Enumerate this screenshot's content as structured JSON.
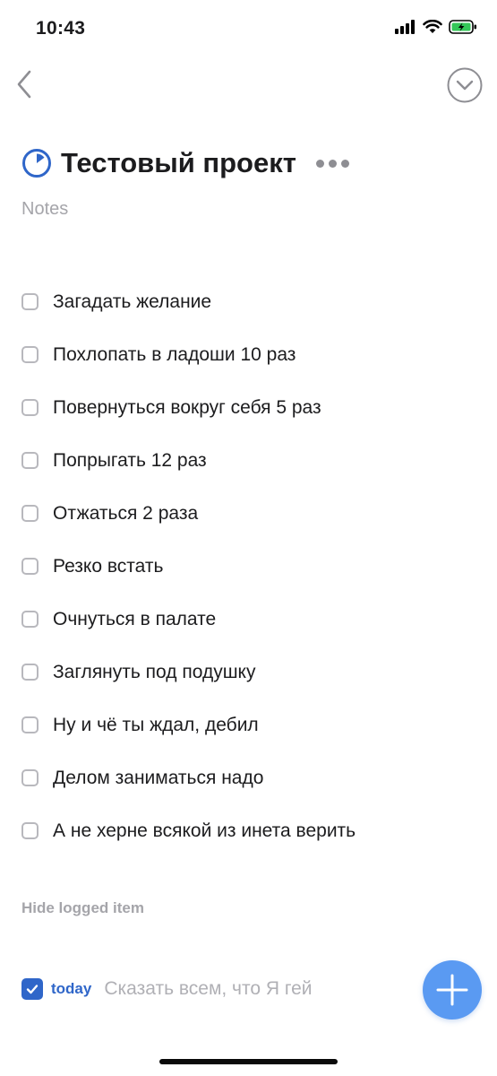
{
  "status_bar": {
    "time": "10:43",
    "icons": [
      "cellular-signal-icon",
      "wifi-icon",
      "battery-charging-icon"
    ]
  },
  "nav": {
    "back_icon": "chevron-left-icon",
    "done_icon": "circle-chevron-down-icon"
  },
  "project": {
    "icon": "project-progress-icon",
    "title": "Тестовый проект",
    "more_icon": "more-horizontal-icon",
    "notes_placeholder": "Notes"
  },
  "tasks": [
    {
      "title": "Загадать желание",
      "done": false
    },
    {
      "title": "Похлопать в ладоши 10 раз",
      "done": false
    },
    {
      "title": "Повернуться вокруг себя 5 раз",
      "done": false
    },
    {
      "title": "Попрыгать 12 раз",
      "done": false
    },
    {
      "title": "Отжаться 2 раза",
      "done": false
    },
    {
      "title": "Резко встать",
      "done": false
    },
    {
      "title": "Очнуться в палате",
      "done": false
    },
    {
      "title": "Заглянуть под подушку",
      "done": false
    },
    {
      "title": "Ну и чё ты ждал, дебил",
      "done": false
    },
    {
      "title": "Делом заниматься надо",
      "done": false
    },
    {
      "title": "А не херне всякой из инета верить",
      "done": false
    }
  ],
  "logged": {
    "toggle_label": "Hide logged item",
    "items": [
      {
        "when": "today",
        "title": "Сказать всем, что Я гей",
        "done": true
      }
    ]
  },
  "fab": {
    "icon": "plus-icon"
  },
  "colors": {
    "accent": "#2f66c9",
    "fab": "#5a9af2",
    "muted_text": "#a5a5aa",
    "checkbox_border": "#b8b8bd",
    "battery_charging": "#34c759"
  }
}
